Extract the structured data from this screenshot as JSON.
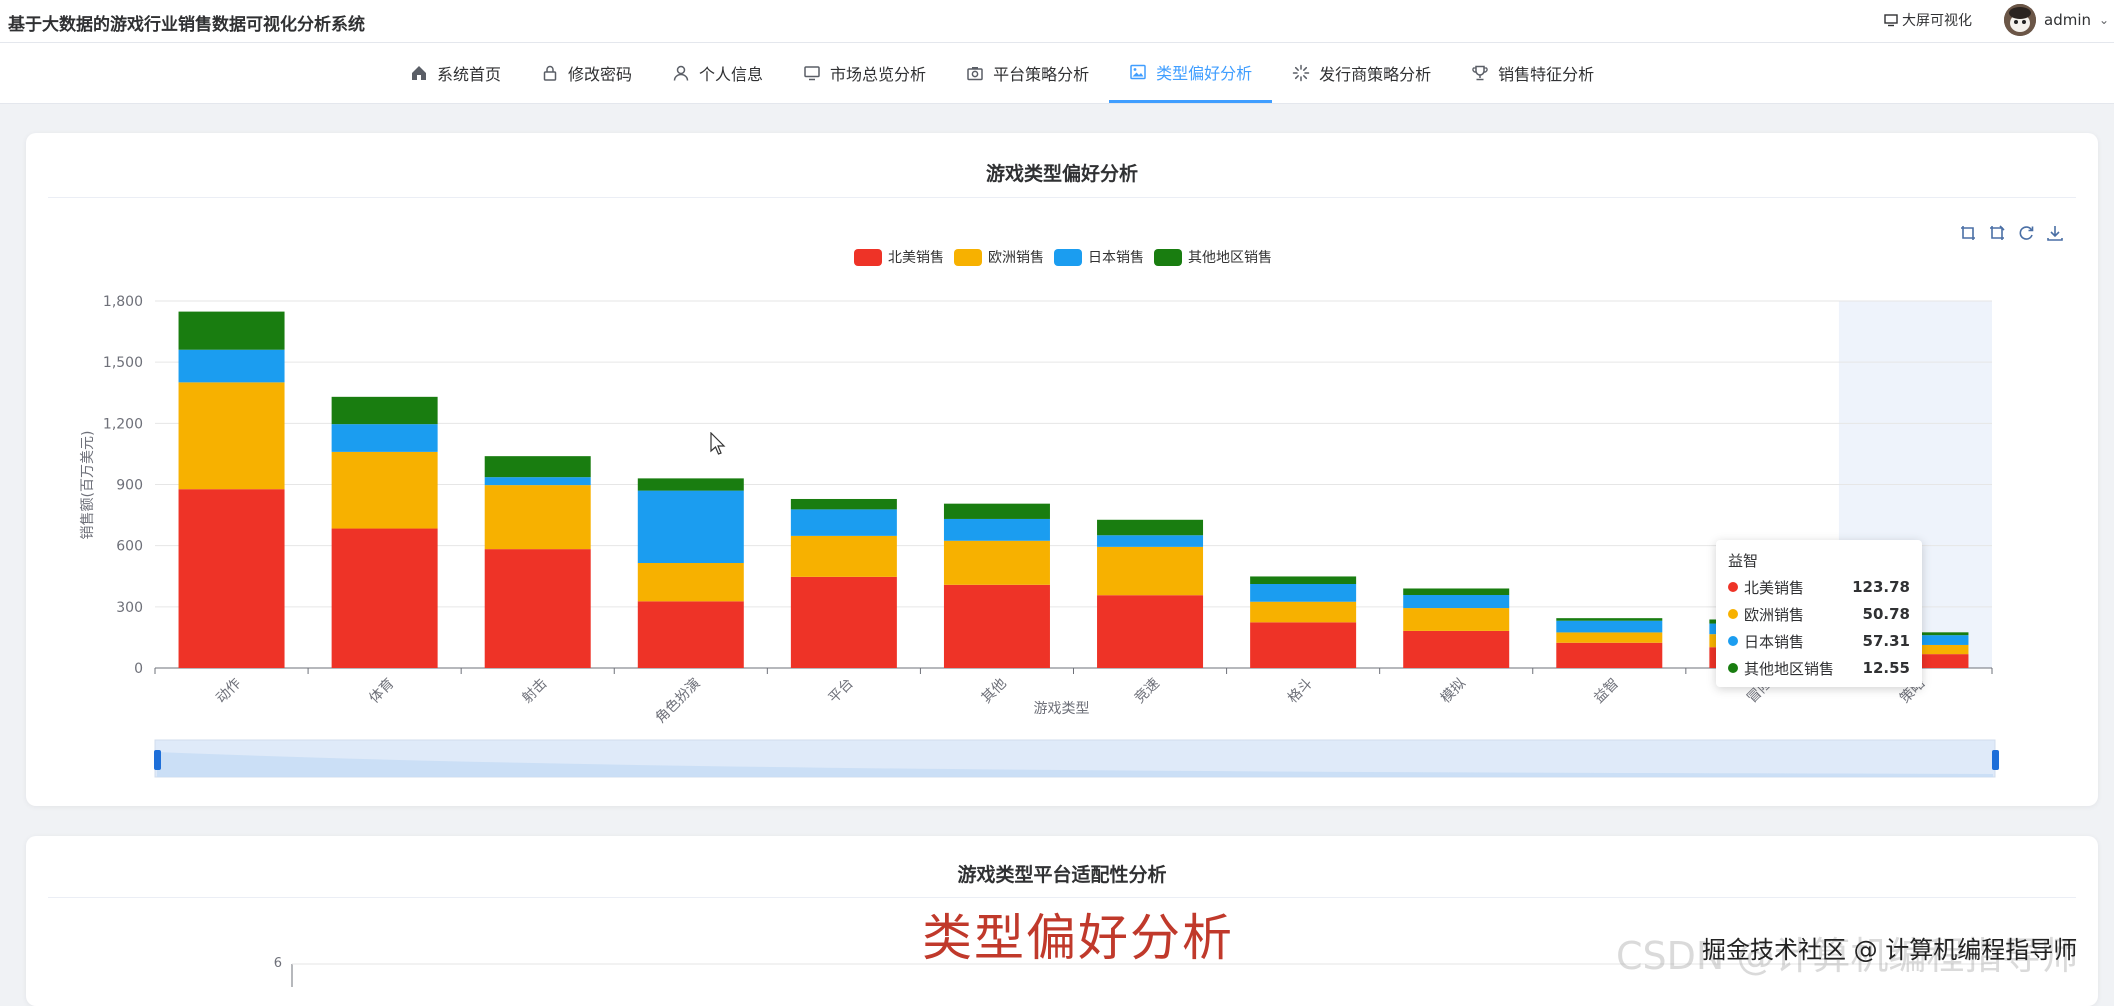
{
  "app": {
    "title": "基于大数据的游戏行业销售数据可视化分析系统",
    "bigscreen_label": "大屏可视化",
    "username": "admin"
  },
  "nav": {
    "items": [
      {
        "label": "系统首页",
        "icon": "home-icon"
      },
      {
        "label": "修改密码",
        "icon": "lock-icon"
      },
      {
        "label": "个人信息",
        "icon": "user-icon"
      },
      {
        "label": "市场总览分析",
        "icon": "monitor-icon"
      },
      {
        "label": "平台策略分析",
        "icon": "camera-icon"
      },
      {
        "label": "类型偏好分析",
        "icon": "picture-icon",
        "active": true
      },
      {
        "label": "发行商策略分析",
        "icon": "loading-icon"
      },
      {
        "label": "销售特征分析",
        "icon": "trophy-icon"
      }
    ]
  },
  "card1": {
    "title": "游戏类型偏好分析"
  },
  "card2": {
    "title": "游戏类型平台适配性分析",
    "ytick_top": "6"
  },
  "chart_data": {
    "type": "bar",
    "stacked": true,
    "title": "",
    "xlabel": "游戏类型",
    "ylabel": "销售额(百万美元)",
    "ylim": [
      0,
      1800
    ],
    "yticks": [
      "0",
      "300",
      "600",
      "900",
      "1,200",
      "1,500",
      "1,800"
    ],
    "grid": true,
    "legend_position": "top-center",
    "categories": [
      "动作",
      "体育",
      "射击",
      "角色扮演",
      "平台",
      "其他",
      "竞速",
      "格斗",
      "模拟",
      "益智",
      "冒险",
      "策略"
    ],
    "series": [
      {
        "name": "北美销售",
        "color": "#ee3327",
        "values": [
          877,
          684,
          583,
          327,
          447,
          408,
          357,
          224,
          182,
          123.78,
          102,
          68
        ]
      },
      {
        "name": "欧洲销售",
        "color": "#f7b100",
        "values": [
          524,
          376,
          314,
          188,
          201,
          216,
          237,
          101,
          112,
          50.78,
          64,
          45
        ]
      },
      {
        "name": "日本销售",
        "color": "#1b9df0",
        "values": [
          160,
          136,
          39,
          355,
          130,
          107,
          57,
          87,
          64,
          57.31,
          52,
          48
        ]
      },
      {
        "name": "其他地区销售",
        "color": "#197d10",
        "values": [
          187,
          134,
          103,
          60,
          51,
          75,
          76,
          37,
          32,
          12.55,
          20,
          14
        ]
      }
    ],
    "tooltip": {
      "category": "益智",
      "rows": [
        {
          "name": "北美销售",
          "value": "123.78",
          "color": "#ee3327"
        },
        {
          "name": "欧洲销售",
          "value": "50.78",
          "color": "#f7b100"
        },
        {
          "name": "日本销售",
          "value": "57.31",
          "color": "#1b9df0"
        },
        {
          "name": "其他地区销售",
          "value": "12.55",
          "color": "#197d10"
        }
      ]
    },
    "toolbox": [
      "zoom-icon",
      "zoom-reset-icon",
      "restore-icon",
      "download-icon"
    ]
  },
  "overlay": {
    "big_caption": "类型偏好分析",
    "csdn_mark": "CSDN @计算机编程指导师",
    "juejin_mark": "掘金技术社区 @ 计算机编程指导师"
  }
}
